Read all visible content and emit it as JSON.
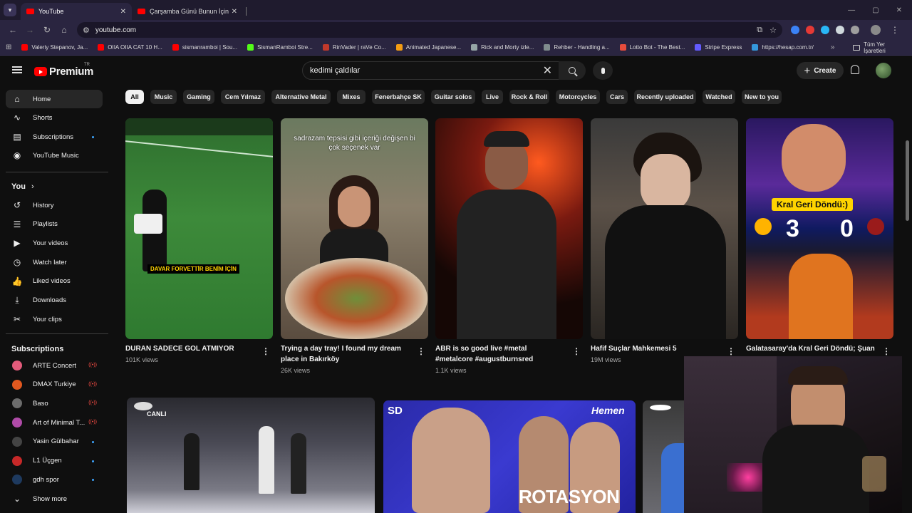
{
  "browser": {
    "tabs": [
      {
        "title": "YouTube"
      },
      {
        "title": "Çarşamba Günü Bunun İçin Gel"
      }
    ],
    "url": "youtube.com",
    "bookmarks": [
      {
        "label": "Valeriy Stepanov, Ja...",
        "color": "#ff0000"
      },
      {
        "label": "OIIA OIIA CAT 10 H...",
        "color": "#ff0000"
      },
      {
        "label": "sismanramboi | Sou...",
        "color": "#ff0000"
      },
      {
        "label": "SismanRamboi Stre...",
        "color": "#53fc18"
      },
      {
        "label": "RinVader | raVe Co...",
        "color": "#c0392b"
      },
      {
        "label": "Animated Japanese...",
        "color": "#f39c12"
      },
      {
        "label": "Rick and Morty izle...",
        "color": "#95a5a6"
      },
      {
        "label": "Rehber - Handling a...",
        "color": "#7f8c8d"
      },
      {
        "label": "Lotto Bot - The Best...",
        "color": "#e74c3c"
      },
      {
        "label": "Stripe Express",
        "color": "#635bff"
      },
      {
        "label": "https://hesap.com.tr/",
        "color": "#3498db"
      }
    ],
    "bookmarks_folder": "Tüm Yer İşaretleri"
  },
  "header": {
    "logo_text": "Premium",
    "logo_region": "TR",
    "search_value": "kedimi çaldılar",
    "create_label": "Create"
  },
  "sidebar": {
    "main": [
      {
        "label": "Home",
        "icon": "⌂"
      },
      {
        "label": "Shorts",
        "icon": "∿"
      },
      {
        "label": "Subscriptions",
        "icon": "▤"
      },
      {
        "label": "YouTube Music",
        "icon": "◉"
      }
    ],
    "you_heading": "You",
    "you_items": [
      {
        "label": "History",
        "icon": "↺"
      },
      {
        "label": "Playlists",
        "icon": "☰"
      },
      {
        "label": "Your videos",
        "icon": "▶"
      },
      {
        "label": "Watch later",
        "icon": "◷"
      },
      {
        "label": "Liked videos",
        "icon": "👍"
      },
      {
        "label": "Downloads",
        "icon": "⤓"
      },
      {
        "label": "Your clips",
        "icon": "✂"
      }
    ],
    "subs_heading": "Subscriptions",
    "subs": [
      {
        "label": "ARTE Concert",
        "color": "#e35b7b",
        "badge": "live"
      },
      {
        "label": "DMAX Turkiye",
        "color": "#e2581f",
        "badge": "live"
      },
      {
        "label": "Baso",
        "color": "#6c6c6c",
        "badge": "live"
      },
      {
        "label": "Art of Minimal T...",
        "color": "#b04ba8",
        "badge": "live"
      },
      {
        "label": "Yasin Gülbahar",
        "color": "#444444",
        "badge": "dot"
      },
      {
        "label": "L1 Üçgen",
        "color": "#c62828",
        "badge": "dot"
      },
      {
        "label": "gdh spor",
        "color": "#1e3a5f",
        "badge": "dot"
      }
    ],
    "show_more": "Show more"
  },
  "chips": [
    "All",
    "Music",
    "Gaming",
    "Cem Yılmaz",
    "Alternative Metal",
    "Mixes",
    "Fenerbahçe SK",
    "Guitar solos",
    "Live",
    "Rock & Roll",
    "Motorcycles",
    "Cars",
    "Recently uploaded",
    "Watched",
    "New to you"
  ],
  "shorts": [
    {
      "title": "DURAN SADECE GOL ATMIYOR",
      "views": "101K views",
      "overlay": "DAVAR FORVETTİR BENİM İÇİN"
    },
    {
      "title": "Trying a day tray! I found my dream place in Bakırköy",
      "views": "26K views",
      "overlay": "sadrazam tepsisi gibi içeriği değişen bi çok seçenek var"
    },
    {
      "title": "ABR is so good live #metal #metalcore #augustburnsred",
      "views": "1.1K views",
      "overlay": ""
    },
    {
      "title": "Hafif Suçlar Mahkemesi 5",
      "views": "19M views",
      "overlay": ""
    },
    {
      "title": "Galatasaray'da Kral Geri Döndü; Şuan",
      "views": "",
      "overlay": "Kral Geri Döndü:)"
    }
  ],
  "bottom_row": [
    {
      "badge": "CANLI"
    },
    {
      "badge": "SD",
      "brand": "Hemen",
      "caption": "ROTASYON"
    }
  ]
}
